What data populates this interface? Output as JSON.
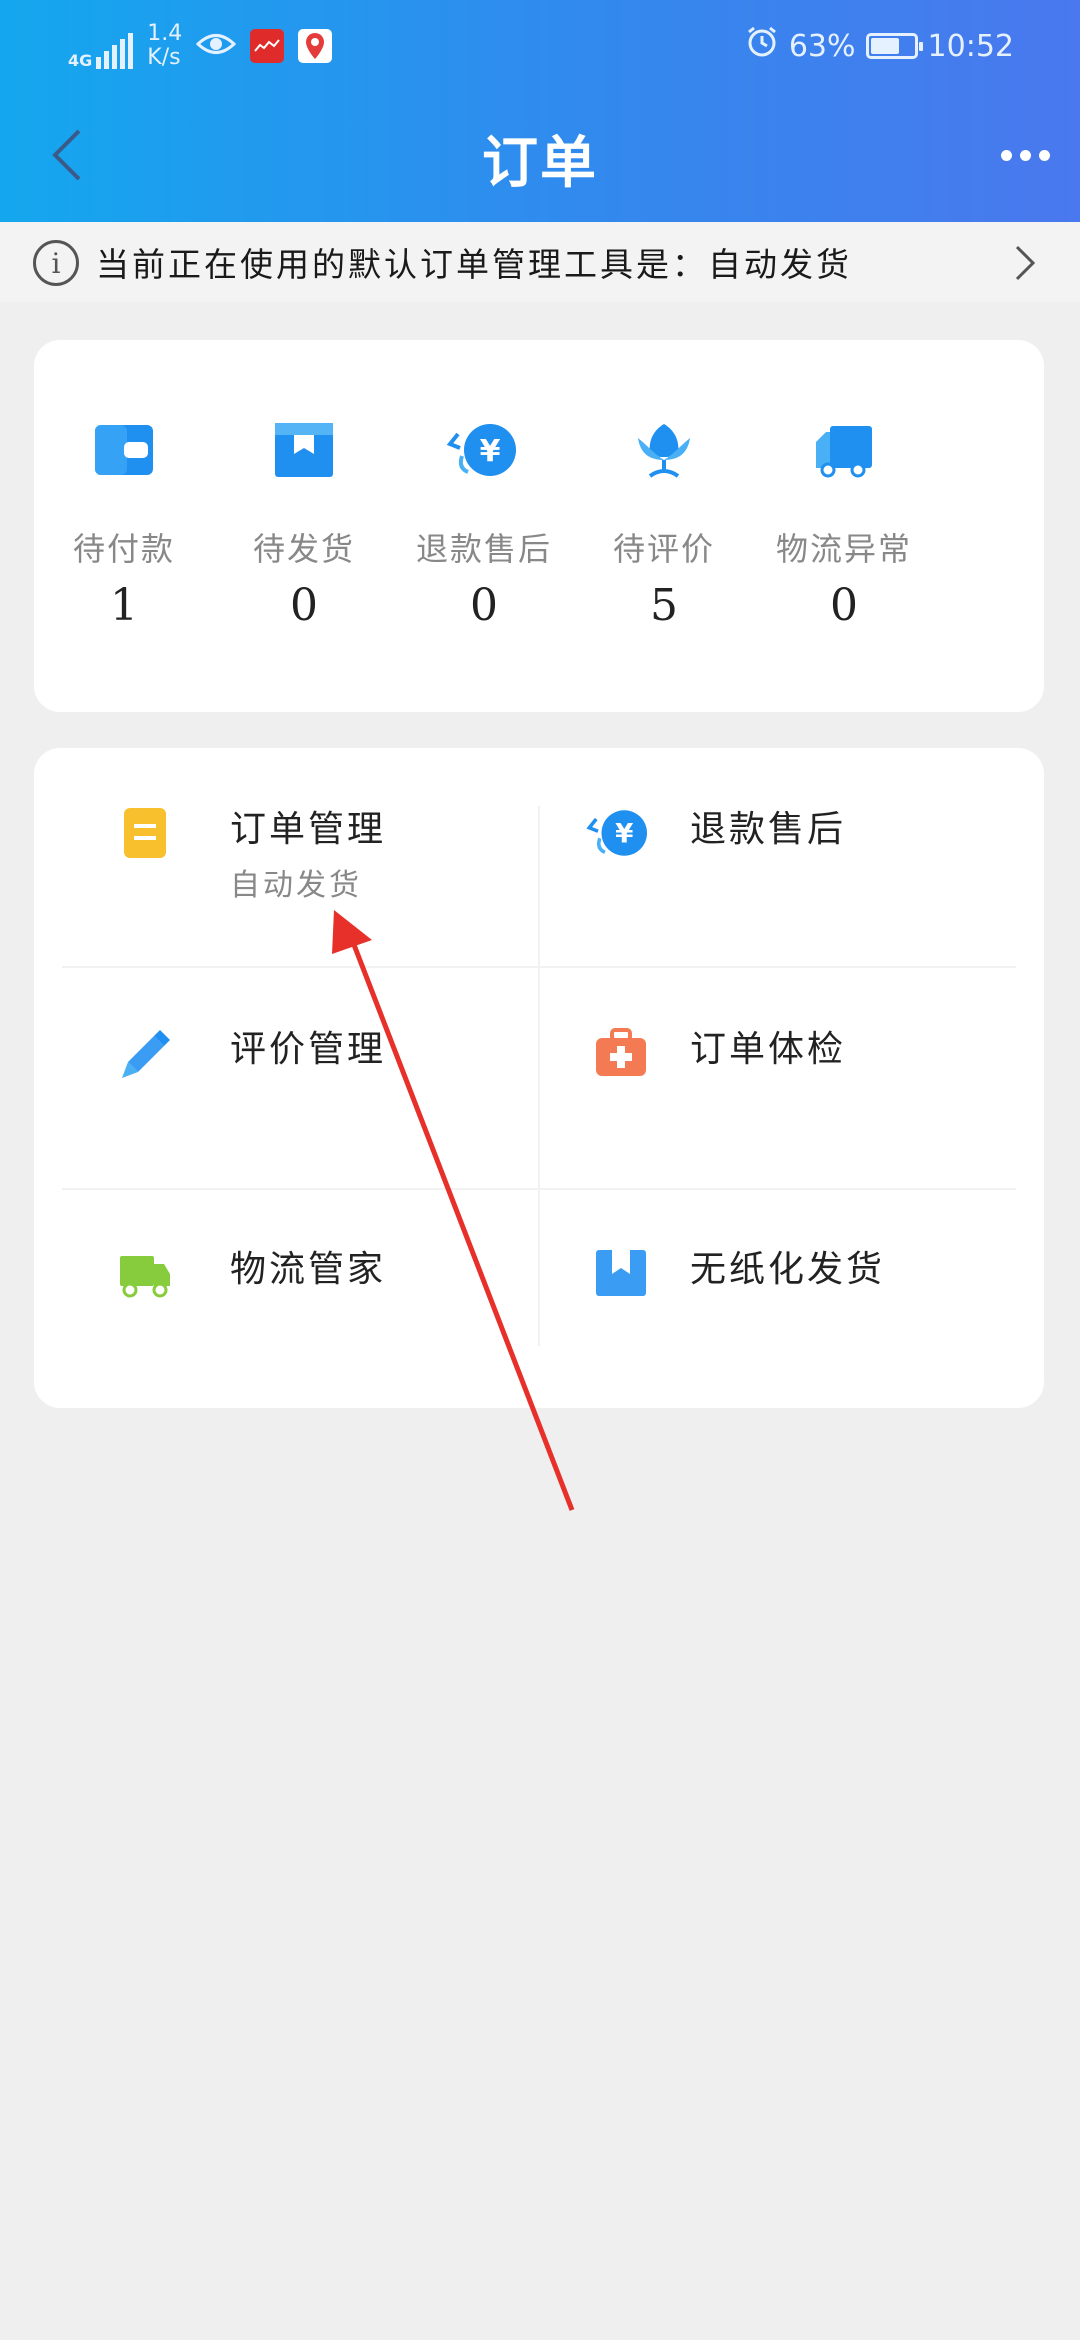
{
  "status_bar": {
    "network": "4G",
    "speed_value": "1.4",
    "speed_unit": "K/s",
    "battery": "63%",
    "battery_level": 0.63,
    "time": "10:52"
  },
  "nav": {
    "title": "订单"
  },
  "notice": {
    "text": "当前正在使用的默认订单管理工具是：自动发货"
  },
  "stats": [
    {
      "label": "待付款",
      "count": "1",
      "icon": "wallet-icon"
    },
    {
      "label": "待发货",
      "count": "0",
      "icon": "package-icon"
    },
    {
      "label": "退款售后",
      "count": "0",
      "icon": "refund-yen-icon"
    },
    {
      "label": "待评价",
      "count": "5",
      "icon": "flower-icon"
    },
    {
      "label": "物流异常",
      "count": "0",
      "icon": "truck-icon"
    }
  ],
  "menu": [
    {
      "label": "订单管理",
      "sub": "自动发货",
      "icon": "document-icon"
    },
    {
      "label": "退款售后",
      "sub": "",
      "icon": "refund-yen-icon"
    },
    {
      "label": "评价管理",
      "sub": "",
      "icon": "pencil-icon"
    },
    {
      "label": "订单体检",
      "sub": "",
      "icon": "medical-kit-icon"
    },
    {
      "label": "物流管家",
      "sub": "",
      "icon": "truck-icon"
    },
    {
      "label": "无纸化发货",
      "sub": "",
      "icon": "box-icon"
    }
  ],
  "colors": {
    "header_start": "#14a7ee",
    "header_end": "#4a78ee",
    "icon_blue": "#1f8ff0",
    "icon_yellow": "#f9c02e",
    "icon_orange": "#f47a54",
    "icon_green": "#86cc3c",
    "annotation_red": "#e8302a"
  }
}
